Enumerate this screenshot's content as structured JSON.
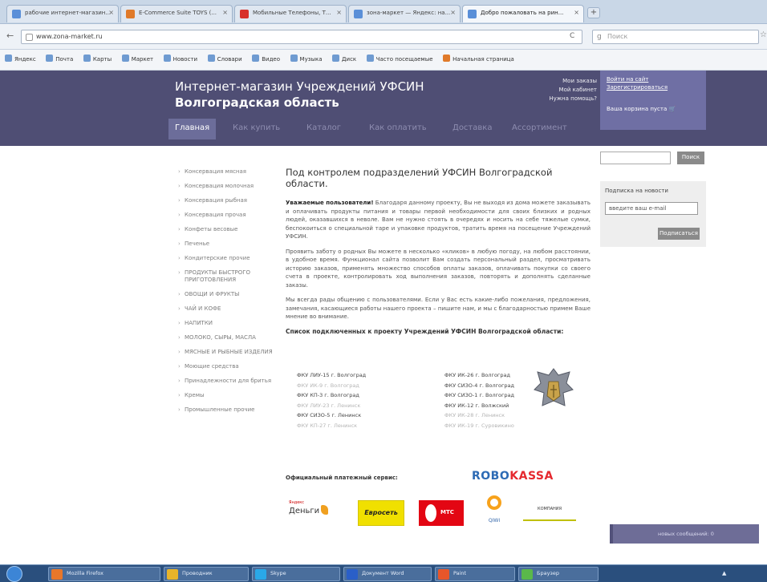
{
  "browser": {
    "tabs": [
      {
        "label": "рабочие интернет-магазин...",
        "color": "#5a8fd8"
      },
      {
        "label": "E-Commerce Suite TOYS (...",
        "color": "#e07a2a"
      },
      {
        "label": "Мобильные Телефоны, Т...",
        "color": "#d8302a"
      },
      {
        "label": "зона-маркет — Яндекс: на...",
        "color": "#5a8fd8"
      },
      {
        "label": "Добро пожаловать на рин...",
        "color": "#5a8fd8"
      }
    ],
    "new_tab": "+",
    "back_icon": "←",
    "url": "www.zona-market.ru",
    "reload_icon": "C",
    "search_placeholder": "Поиск",
    "search_engine_icon": "g",
    "star_icon": "☆",
    "bookmarks": [
      "Яндекс",
      "Почта",
      "Карты",
      "Маркет",
      "Новости",
      "Словари",
      "Видео",
      "Музыка",
      "Диск",
      "Часто посещаемые",
      "Начальная страница"
    ]
  },
  "site": {
    "title": "Интернет-магазин Учреждений УФСИН",
    "subtitle": "Волгоградская область",
    "help_links": [
      "Мои заказы",
      "Мой кабинет",
      "Нужна помощь?"
    ],
    "login_links": [
      "Войти на сайт",
      "Зарегистрироваться"
    ],
    "cart_text": "Ваша корзина пуста",
    "cart_icon": "🛒",
    "menu": [
      {
        "label": "Главная",
        "active": true
      },
      {
        "label": "Как купить",
        "active": false
      },
      {
        "label": "Каталог",
        "active": false
      },
      {
        "label": "Как оплатить",
        "active": false
      },
      {
        "label": "Доставка",
        "active": false
      },
      {
        "label": "Ассортимент",
        "active": false
      }
    ]
  },
  "sidebar": {
    "categories": [
      "Консервация мясная",
      "Консервация молочная",
      "Консервация рыбная",
      "Консервация прочая",
      "Конфеты весовые",
      "Печенье",
      "Кондитерские прочие",
      "ПРОДУКТЫ БЫСТРОГО ПРИГОТОВЛЕНИЯ",
      "ОВОЩИ И ФРУКТЫ",
      "ЧАЙ И КОФЕ",
      "НАПИТКИ",
      "МОЛОКО, СЫРЫ, МАСЛА",
      "МЯСНЫЕ И РЫБНЫЕ ИЗДЕЛИЯ",
      "Моющие средства",
      "Принадлежности для бритья",
      "Кремы",
      "Промышленные прочие"
    ]
  },
  "main": {
    "heading": "Под контролем подразделений УФСИН Волгоградской области.",
    "para1_bold": "Уважаемые пользователи!",
    "para1": " Благодаря данному проекту, Вы не выходя из дома можете заказывать и оплачивать продукты питания и товары первой необходимости для своих близких и родных людей, оказавшихся в неволе. Вам не нужно стоять в очередях и носить на себе тяжелые сумки, беспокоиться о специальной таре и упаковке продуктов, тратить время на посещение Учреждений УФСИН.",
    "para2": "Проявить заботу о родных Вы можете в несколько «кликов» в любую погоду, на любом расстоянии, в удобное время. Функционал сайта позволит Вам создать персональный раздел, просматривать историю заказов, применять множество способов оплаты заказов, оплачивать покупки со своего счета в проекте, контролировать ход выполнения заказов, повторять и дополнять сделанные заказы.",
    "para3": "Мы всегда рады общению с пользователями. Если у Вас есть какие-либо пожелания, предложения, замечания, касающиеся работы нашего проекта – пишите нам, и мы с благодарностью примем Ваше мнение во внимание.",
    "list_title": "Список подключенных к проекту Учреждений УФСИН Волгоградской области:",
    "institutions_left": [
      {
        "name": "ФКУ ЛИУ-15 г. Волгоград",
        "faded": false
      },
      {
        "name": "ФКУ ИК-9 г. Волгоград",
        "faded": true
      },
      {
        "name": "ФКУ КП-3 г. Волгоград",
        "faded": false
      },
      {
        "name": "ФКУ ЛИУ-23 г. Ленинск",
        "faded": true
      },
      {
        "name": "ФКУ СИЗО-5 г. Ленинск",
        "faded": false
      },
      {
        "name": "ФКУ КП-27 г. Ленинск",
        "faded": true
      }
    ],
    "institutions_right": [
      {
        "name": "ФКУ ИК-26 г. Волгоград",
        "faded": false
      },
      {
        "name": "ФКУ СИЗО-4 г. Волгоград",
        "faded": false
      },
      {
        "name": "ФКУ СИЗО-1 г. Волгоград",
        "faded": false
      },
      {
        "name": "ФКУ ИК-12 г. Волжский",
        "faded": false
      },
      {
        "name": "ФКУ ИК-28 г. Ленинск",
        "faded": true
      },
      {
        "name": "ФКУ ИК-19 г. Суровикино",
        "faded": true
      }
    ],
    "payment_title": "Официальный платежный сервис:",
    "robokassa_robo": "ROBO",
    "robokassa_kassa": "KASSA",
    "yandex_small": "Яндекс",
    "yandex_big": "Деньги",
    "euroset": "Евросеть",
    "mts": "МТС",
    "qiwi": "QIWI",
    "mbanking": "КОМПАНИЯ"
  },
  "right": {
    "search_button": "Поиск",
    "subscribe_label": "Подписка на новости",
    "email_value": "введите ваш e-mail",
    "subscribe_button": "Подписаться",
    "news_bar": "новых сообщений: 0"
  },
  "taskbar": {
    "items": [
      {
        "label": "Mozilla Firefox",
        "color": "#e8772a"
      },
      {
        "label": "Проводник",
        "color": "#e8b42a"
      },
      {
        "label": "Skype",
        "color": "#2aa8e8"
      },
      {
        "label": "Документ Word",
        "color": "#2a5fc8"
      },
      {
        "label": "Paint",
        "color": "#e8562a"
      },
      {
        "label": "Браузер",
        "color": "#5ab84a"
      }
    ]
  }
}
